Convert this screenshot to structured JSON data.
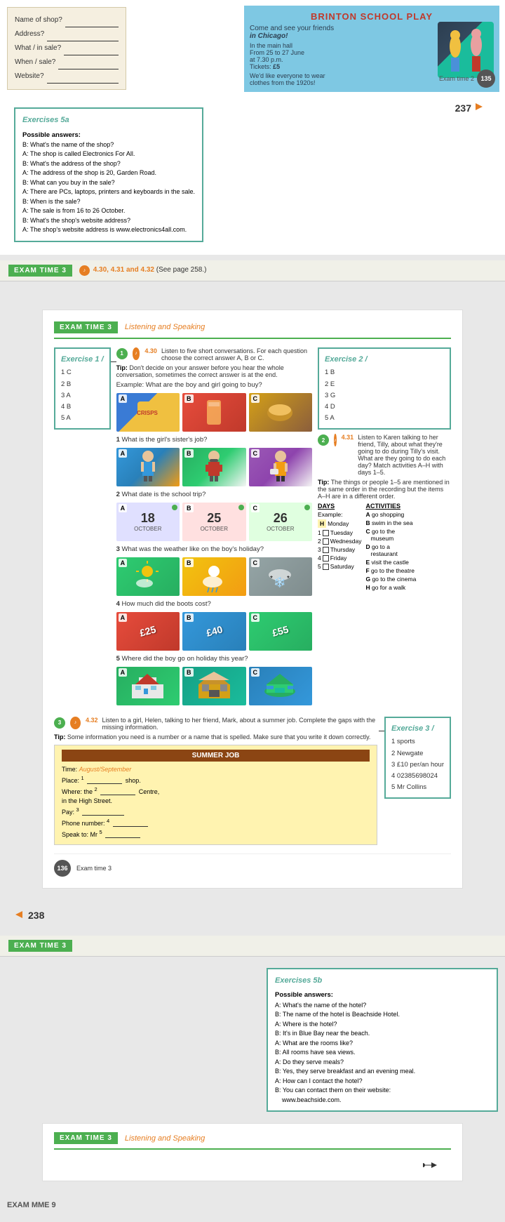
{
  "page": {
    "top": {
      "form": {
        "fields": [
          {
            "label": "Name of shop?",
            "blank": true
          },
          {
            "label": "Address?",
            "blank": true
          },
          {
            "label": "What / in sale?",
            "blank": true
          },
          {
            "label": "When / sale?",
            "blank": true
          },
          {
            "label": "Website?",
            "blank": true
          }
        ]
      },
      "poster": {
        "title": "BRINTON SCHOOL PL",
        "tagline": "Come and see your friends",
        "show_in": "in Chicago!",
        "venue": "In the main hall",
        "dates": "From 25 to 27 June",
        "time": "at 7.30 p.m.",
        "tickets_label": "Tickets:",
        "tickets_price": "£5",
        "dress_code": "We'd like everyone to wear clothes from the 1920s!"
      },
      "exam_time_label": "Exam time 2",
      "exam_time_num": "135"
    },
    "exercises5a": {
      "title": "Exercises 5a",
      "label": "Possible answers:",
      "qa": [
        "B:  What's the name of the shop?",
        "A:  The shop is called Electronics For All.",
        "B:  What's the address of the shop?",
        "A:  The address of the shop is 20, Garden Road.",
        "B:  What can you buy in the sale?",
        "A:  There are PCs, laptops, printers and keyboards in the sale.",
        "B:  When is the sale?",
        "A:  The sale is from 16 to 26 October.",
        "B:  What's the shop's website address?",
        "A:  The shop's website address is www.electronics4all.com."
      ]
    },
    "page_num_237": "237",
    "exam_time_3_banner": {
      "badge": "EXAM TIME 3",
      "audio": "4.30, 4.31 and 4.32",
      "ref": "(See page 258.)"
    },
    "main_card": {
      "header_badge": "EXAM TIME 3",
      "header_subtitle": "Listening and Speaking",
      "exercise1": {
        "sidebar": {
          "title": "Exercise 1",
          "items": [
            "1 C",
            "2 B",
            "3 A",
            "4 B",
            "5 A"
          ]
        },
        "audio_num": "4.30",
        "instruction": "Listen to five short conversations. For each question choose the correct answer A, B or C.",
        "tip": "Tip: Don't decide on your answer before you hear the whole conversation, sometimes the correct answer is at the end.",
        "example_label": "Example: What are the boy and girl going to buy?",
        "questions": [
          {
            "num": "1",
            "text": "What is the girl's sister's job?",
            "choices": [
              {
                "label": "A",
                "type": "girl1"
              },
              {
                "label": "B",
                "type": "girl2"
              },
              {
                "label": "C",
                "type": "girl3"
              }
            ]
          },
          {
            "num": "2",
            "text": "What date is the school trip?",
            "choices": [
              {
                "label": "A",
                "date": "18",
                "month": "OCTOBER"
              },
              {
                "label": "B",
                "date": "25",
                "month": "OCTOBER"
              },
              {
                "label": "C",
                "date": "26",
                "month": "OCTOBER"
              }
            ]
          },
          {
            "num": "3",
            "text": "What was the weather like on the boy's holiday?",
            "choices": [
              {
                "label": "A",
                "type": "weather1"
              },
              {
                "label": "B",
                "type": "weather2"
              },
              {
                "label": "C",
                "type": "weather3"
              }
            ]
          },
          {
            "num": "4",
            "text": "How much did the boots cost?",
            "choices": [
              {
                "label": "A",
                "price": "£25"
              },
              {
                "label": "B",
                "price": "£40"
              },
              {
                "label": "C",
                "price": "£55"
              }
            ]
          },
          {
            "num": "5",
            "text": "Where did the boy go on holiday this year?",
            "choices": [
              {
                "label": "A",
                "type": "holiday1"
              },
              {
                "label": "B",
                "type": "holiday2"
              },
              {
                "label": "C",
                "type": "holiday3"
              }
            ]
          }
        ]
      },
      "exercise2": {
        "sidebar": {
          "title": "Exercise 2",
          "items": [
            "1 B",
            "2 E",
            "3 G",
            "4 D",
            "5 A"
          ]
        },
        "audio_num": "4.31",
        "instruction": "Listen to Karen talking to her friend, Tilly, about what they're going to do during Tilly's visit. What are they going to do each day? Match activities A–H with days 1–5.",
        "tip": "Tip: The things or people 1–5 are mentioned in the same order in the recording but the items A–H are in a different order.",
        "days_header": "DAYS",
        "activities_header": "ACTIVITIES",
        "example_label": "Example:",
        "example_day": "H  Monday",
        "days": [
          {
            "num": "1",
            "day": "Tuesday"
          },
          {
            "num": "2",
            "day": "Wednesday"
          },
          {
            "num": "3",
            "day": "Thursday"
          },
          {
            "num": "4",
            "day": "Friday"
          },
          {
            "num": "5",
            "day": "Saturday"
          }
        ],
        "activities": [
          {
            "letter": "A",
            "text": "go shopping"
          },
          {
            "letter": "B",
            "text": "swim in the sea"
          },
          {
            "letter": "C",
            "text": "go to the museum"
          },
          {
            "letter": "D",
            "text": "go to a restaurant"
          },
          {
            "letter": "E",
            "text": "visit the castle"
          },
          {
            "letter": "F",
            "text": "go to the theatre"
          },
          {
            "letter": "G",
            "text": "go to the cinema"
          },
          {
            "letter": "H",
            "text": "go for a walk"
          }
        ]
      },
      "exercise3": {
        "sidebar": {
          "title": "Exercise 3",
          "items": [
            "1  sports",
            "2  Newgate",
            "3  £10 per/an hour",
            "4  02385698024",
            "5  Mr Collins"
          ]
        },
        "audio_num": "4.32",
        "instruction": "Listen to a girl, Helen, talking to her friend, Mark, about a summer job. Complete the gaps with the missing information.",
        "tip": "Tip: Some information you need is a number or a name that is spelled. Make sure that you write it down correctly.",
        "summer_job": {
          "title": "SUMMER JOB",
          "rows": [
            {
              "label": "Time:",
              "value": "August/September"
            },
            {
              "label": "Place:",
              "num": "1",
              "after": "shop."
            },
            {
              "label": "Where: the",
              "num": "2",
              "middle": "Centre,"
            },
            {
              "label": "in the High Street."
            },
            {
              "label": "Pay:",
              "num": "3",
              "blank": true
            },
            {
              "label": "Phone number:",
              "num": "4",
              "blank": true
            },
            {
              "label": "Speak to: Mr",
              "num": "5",
              "blank": true
            }
          ]
        }
      },
      "footer": {
        "page_num": "136",
        "label": "Exam time 3"
      }
    },
    "page_num_238": "238",
    "bottom": {
      "exam_banner": {
        "badge": "EXAM TIME 3"
      },
      "exercises5b": {
        "title": "Exercises 5b",
        "label": "Possible answers:",
        "qa": [
          "A: What's the name of the hotel?",
          "B:  The name of the hotel is Beachside Hotel.",
          "A: Where is the hotel?",
          "B:  It's in Blue Bay near the beach.",
          "A: What are the rooms like?",
          "B:  All rooms have sea views.",
          "A: Do they serve meals?",
          "B:  Yes, they serve breakfast and an evening meal.",
          "A: How can I contact the hotel?",
          "B:  You can contact them on their website: www.beachside.com."
        ]
      },
      "bottom_card": {
        "header_badge": "EXAM TIME 3",
        "header_subtitle": "Listening and Speaking"
      }
    }
  },
  "exam_mme": {
    "label": "EXAM MME 9"
  }
}
